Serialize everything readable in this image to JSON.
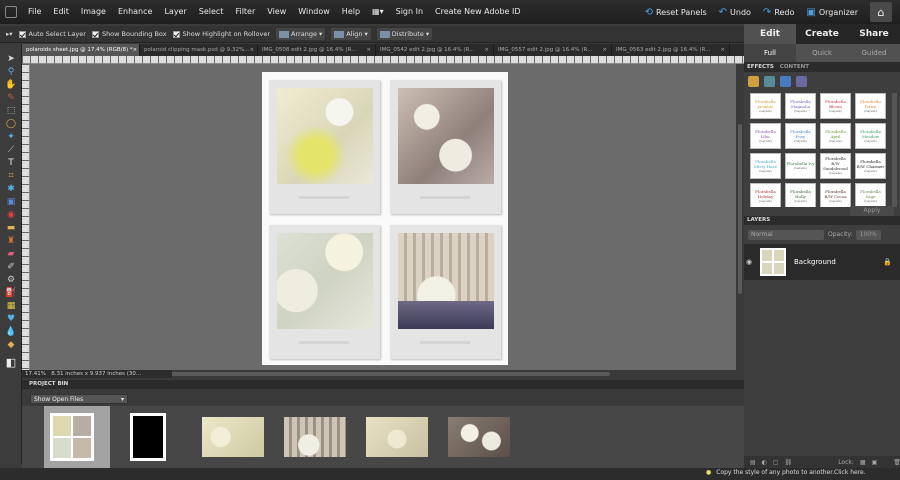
{
  "menubar": {
    "items": [
      "File",
      "Edit",
      "Image",
      "Enhance",
      "Layer",
      "Select",
      "Filter",
      "View",
      "Window",
      "Help"
    ],
    "sign_in": "Sign In",
    "create_id": "Create New Adobe ID",
    "reset_panels": "Reset Panels",
    "undo": "Undo",
    "redo": "Redo",
    "organizer": "Organizer"
  },
  "mode_tabs": {
    "edit": "Edit",
    "create": "Create",
    "share": "Share"
  },
  "sub_tabs": {
    "full": "Full",
    "quick": "Quick",
    "guided": "Guided"
  },
  "options_bar": {
    "auto_select": "Auto Select Layer",
    "bounding_box": "Show Bounding Box",
    "highlight": "Show Highlight on Rollover",
    "arrange": "Arrange",
    "align": "Align",
    "distribute": "Distribute"
  },
  "doc_tabs": [
    "polaroids sheet.jpg @ 17.4% (RGB/8) *",
    "polaroid clipping mask.psd @ 9.32%...",
    "IMG_0508 edit 2.jpg @ 16.4% (R...",
    "IMG_0542 edit 2.jpg @ 16.4% (R...",
    "IMG_0557 edit 2.jpg @ 16.4% (R...",
    "IMG_0563 edit 2.jpg @ 16.4% (R..."
  ],
  "status": {
    "zoom": "17.41%",
    "size": "8.31 inches x 9.937 inches (30..."
  },
  "effects": {
    "tab_effects": "EFFECTS",
    "tab_content": "CONTENT",
    "apply": "Apply",
    "items": [
      {
        "name": "Florabella Jasmine",
        "sub": "(Layers)",
        "color": "#c8a23a"
      },
      {
        "name": "Florabella Magnolia",
        "sub": "(Layers)",
        "color": "#7a62b8"
      },
      {
        "name": "Florabella Bloom",
        "sub": "(Layers)",
        "color": "#c83a4a"
      },
      {
        "name": "Florabella Daisy",
        "sub": "(Layers)",
        "color": "#e08a3a"
      },
      {
        "name": "Florabella Lilac",
        "sub": "(Layers)",
        "color": "#8a5ab0"
      },
      {
        "name": "Florabella Posy",
        "sub": "(Layers)",
        "color": "#4a8ac0"
      },
      {
        "name": "Florabella April",
        "sub": "(Layers)",
        "color": "#6a9a3a"
      },
      {
        "name": "Florabella Meadow",
        "sub": "(Layers)",
        "color": "#3a9a6a"
      },
      {
        "name": "Florabella Misty Haze",
        "sub": "(Layers)",
        "color": "#4ab0c8"
      },
      {
        "name": "Florabella Ivy",
        "sub": "(Layers)",
        "color": "#3a7a4a"
      },
      {
        "name": "Florabella B/W Sandalwood",
        "sub": "(Layers)",
        "color": "#333333"
      },
      {
        "name": "Florabella B/W Charmer",
        "sub": "(Layers)",
        "color": "#222222"
      },
      {
        "name": "Florabella Holiday",
        "sub": "(Layers)",
        "color": "#a03a3a"
      },
      {
        "name": "Florabella Holly",
        "sub": "(Layers)",
        "color": "#3a6a3a"
      },
      {
        "name": "Florabella B/W Cocoa",
        "sub": "(Layers)",
        "color": "#5a3a2a"
      },
      {
        "name": "Florabella Sage",
        "sub": "(Layers)",
        "color": "#6a8a5a"
      }
    ]
  },
  "layers": {
    "title": "LAYERS",
    "blend_mode": "Normal",
    "opacity_label": "Opacity:",
    "opacity_value": "100%",
    "layer_name": "Background",
    "lock_label": "Lock:"
  },
  "project_bin": {
    "title": "PROJECT BIN",
    "selector": "Show Open Files"
  },
  "tip": "Copy the style of any photo to another.Click here."
}
